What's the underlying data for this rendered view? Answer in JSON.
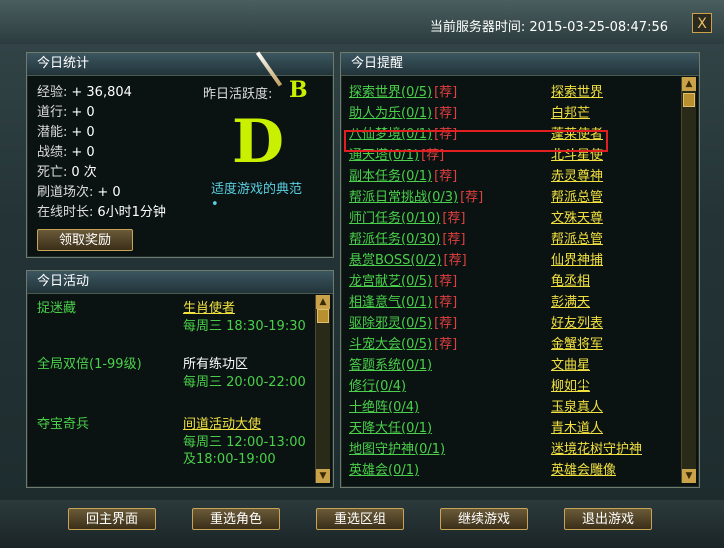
{
  "header": {
    "server_time": "当前服务器时间:  2015-03-25-08:47:56",
    "close": "X"
  },
  "today_stats": {
    "title": "今日统计",
    "rows": [
      {
        "label": "经验:",
        "value": "+ 36,804"
      },
      {
        "label": "道行:",
        "value": "+ 0"
      },
      {
        "label": "潜能:",
        "value": "+ 0"
      },
      {
        "label": "战绩:",
        "value": "+ 0"
      },
      {
        "label": "死亡:",
        "value": "0 次"
      },
      {
        "label": "刷道场次:",
        "value": "+ 0"
      },
      {
        "label": "在线时长:",
        "value": "6小时1分钟"
      }
    ],
    "yesterday_label": "昨日活跃度:",
    "yesterday_grade": "B",
    "today_grade": "D",
    "grade_desc": "适度游戏的典范",
    "claim_button": "领取奖励"
  },
  "today_activity": {
    "title": "今日活动",
    "items": [
      {
        "name": "捉迷藏",
        "target": "生肖使者",
        "target_link": true,
        "times": [
          "每周三  18:30-19:30"
        ]
      },
      {
        "name": "全局双倍(1-99级)",
        "target": "所有练功区",
        "target_link": false,
        "times": [
          "每周三  20:00-22:00"
        ]
      },
      {
        "name": "夺宝奇兵",
        "target": "间道活动大使",
        "target_link": true,
        "times": [
          "每周三  12:00-13:00",
          "及18:00-19:00"
        ]
      }
    ]
  },
  "today_reminder": {
    "title": "今日提醒",
    "rec_label": "[荐]",
    "items": [
      {
        "task": "探索世界(0/5)",
        "rec": true,
        "npc": "探索世界"
      },
      {
        "task": "助人为乐(0/1)",
        "rec": true,
        "npc": "白邦芒"
      },
      {
        "task": "八仙梦境(0/1)",
        "rec": true,
        "npc": "蓬莱使者"
      },
      {
        "task": "通天塔(0/1)",
        "rec": true,
        "npc": "北斗星使"
      },
      {
        "task": "副本任务(0/1)",
        "rec": true,
        "npc": "赤灵尊神"
      },
      {
        "task": "帮派日常挑战(0/3)",
        "rec": true,
        "npc": "帮派总管"
      },
      {
        "task": "师门任务(0/10)",
        "rec": true,
        "npc": "文殊天尊"
      },
      {
        "task": "帮派任务(0/30)",
        "rec": true,
        "npc": "帮派总管"
      },
      {
        "task": "悬赏BOSS(0/2)",
        "rec": true,
        "npc": "仙界神捕"
      },
      {
        "task": "龙宫献艺(0/5)",
        "rec": true,
        "npc": "龟丞相"
      },
      {
        "task": "相逢意气(0/1)",
        "rec": true,
        "npc": "彭满天"
      },
      {
        "task": "驱除邪灵(0/5)",
        "rec": true,
        "npc": "好友列表"
      },
      {
        "task": "斗宠大会(0/5)",
        "rec": true,
        "npc": "金蟹将军"
      },
      {
        "task": "答题系统(0/1)",
        "rec": false,
        "npc": "文曲星"
      },
      {
        "task": "修行(0/4)",
        "rec": false,
        "npc": "柳如尘"
      },
      {
        "task": "十绝阵(0/4)",
        "rec": false,
        "npc": "玉泉真人"
      },
      {
        "task": "天降大任(0/1)",
        "rec": false,
        "npc": "青木道人"
      },
      {
        "task": "地图守护神(0/1)",
        "rec": false,
        "npc": "迷境花树守护神"
      },
      {
        "task": "英雄会(0/1)",
        "rec": false,
        "npc": "英雄会雕像"
      }
    ]
  },
  "bottom_buttons": [
    "回主界面",
    "重选角色",
    "重选区组",
    "继续游戏",
    "退出游戏"
  ],
  "colors": {
    "accent": "#c8a456",
    "task_green": "#4ad04a",
    "npc_yellow": "#f0e040",
    "rec_red": "#e04040",
    "grade": "#c8f000"
  }
}
